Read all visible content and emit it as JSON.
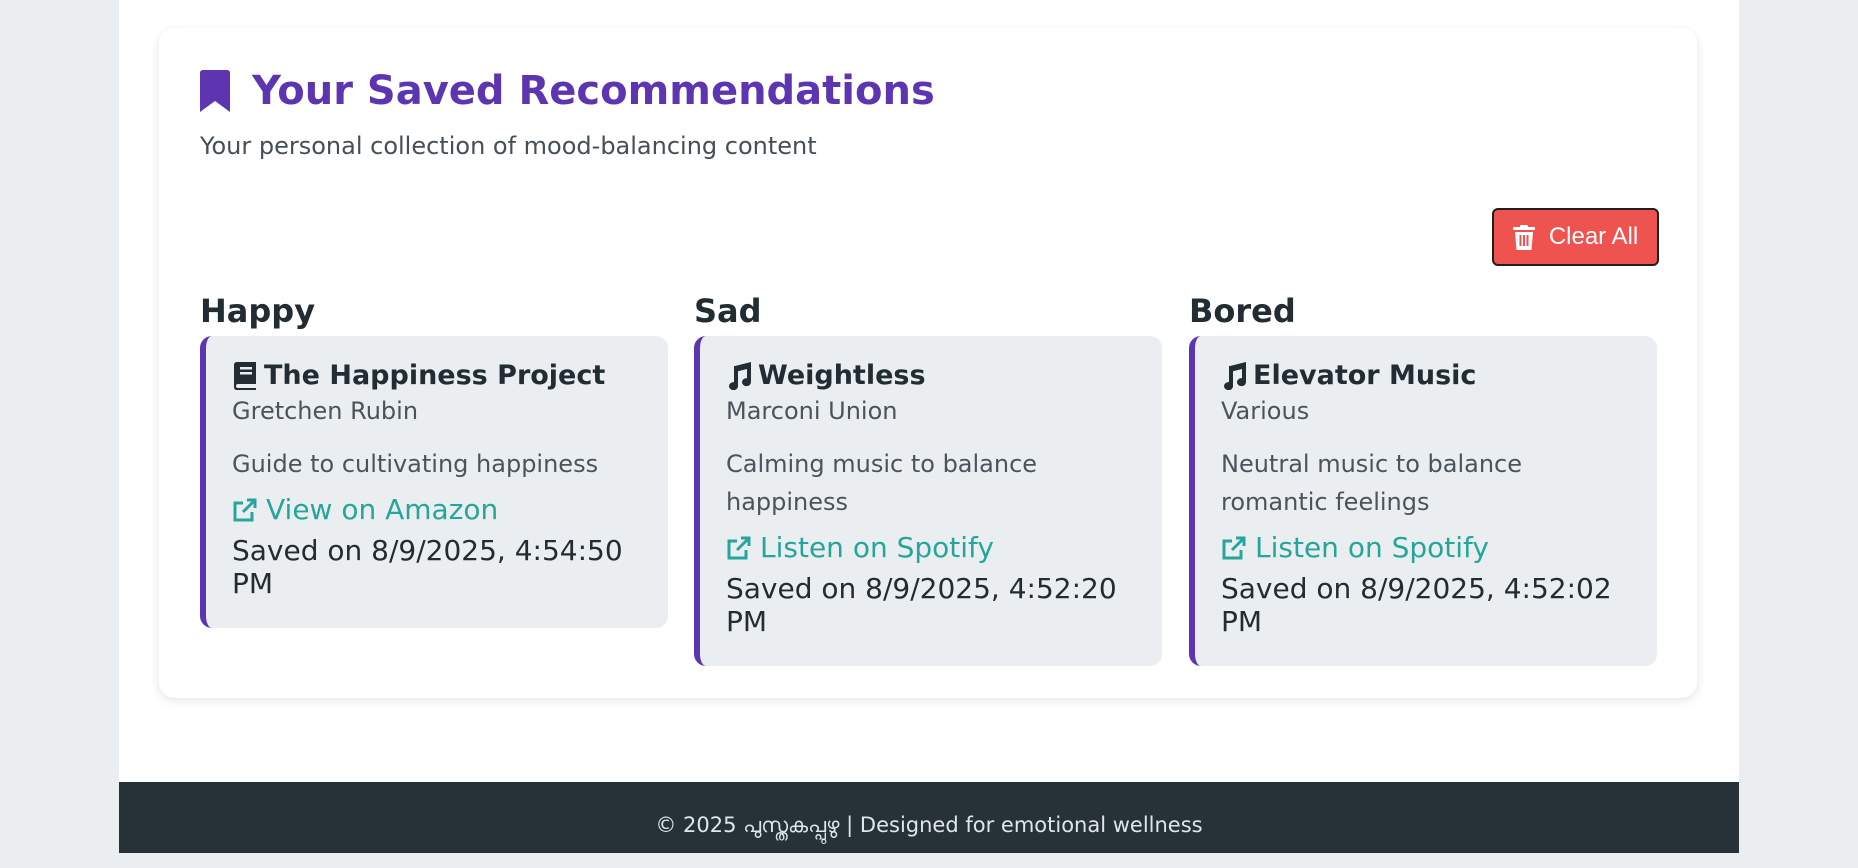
{
  "header": {
    "title": "Your Saved Recommendations",
    "subtitle": "Your personal collection of mood-balancing content",
    "icon": "bookmark-icon"
  },
  "actions": {
    "clear_all_label": "Clear All",
    "clear_all_icon": "trash-icon"
  },
  "columns": [
    {
      "mood": "Happy",
      "item": {
        "type_icon": "book-icon",
        "title": "The Happiness Project",
        "author": "Gretchen Rubin",
        "description": "Guide to cultivating happiness",
        "link_label": "View on Amazon",
        "saved": "Saved on 8/9/2025, 4:54:50 PM"
      }
    },
    {
      "mood": "Sad",
      "item": {
        "type_icon": "music-icon",
        "title": "Weightless",
        "author": "Marconi Union",
        "description": "Calming music to balance happiness",
        "link_label": "Listen on Spotify",
        "saved": "Saved on 8/9/2025, 4:52:20 PM"
      }
    },
    {
      "mood": "Bored",
      "item": {
        "type_icon": "music-icon",
        "title": "Elevator Music",
        "author": "Various",
        "description": "Neutral music to balance romantic feelings",
        "link_label": "Listen on Spotify",
        "saved": "Saved on 8/9/2025, 4:52:02 PM"
      }
    }
  ],
  "footer": {
    "text": "© 2025 പുസ്തകപ്പുഴു | Designed for emotional wellness"
  },
  "colors": {
    "accent": "#5e35b1",
    "link": "#26a69a",
    "danger": "#ef5350",
    "footer_bg": "#263238",
    "card_bg": "#eaeef1"
  }
}
